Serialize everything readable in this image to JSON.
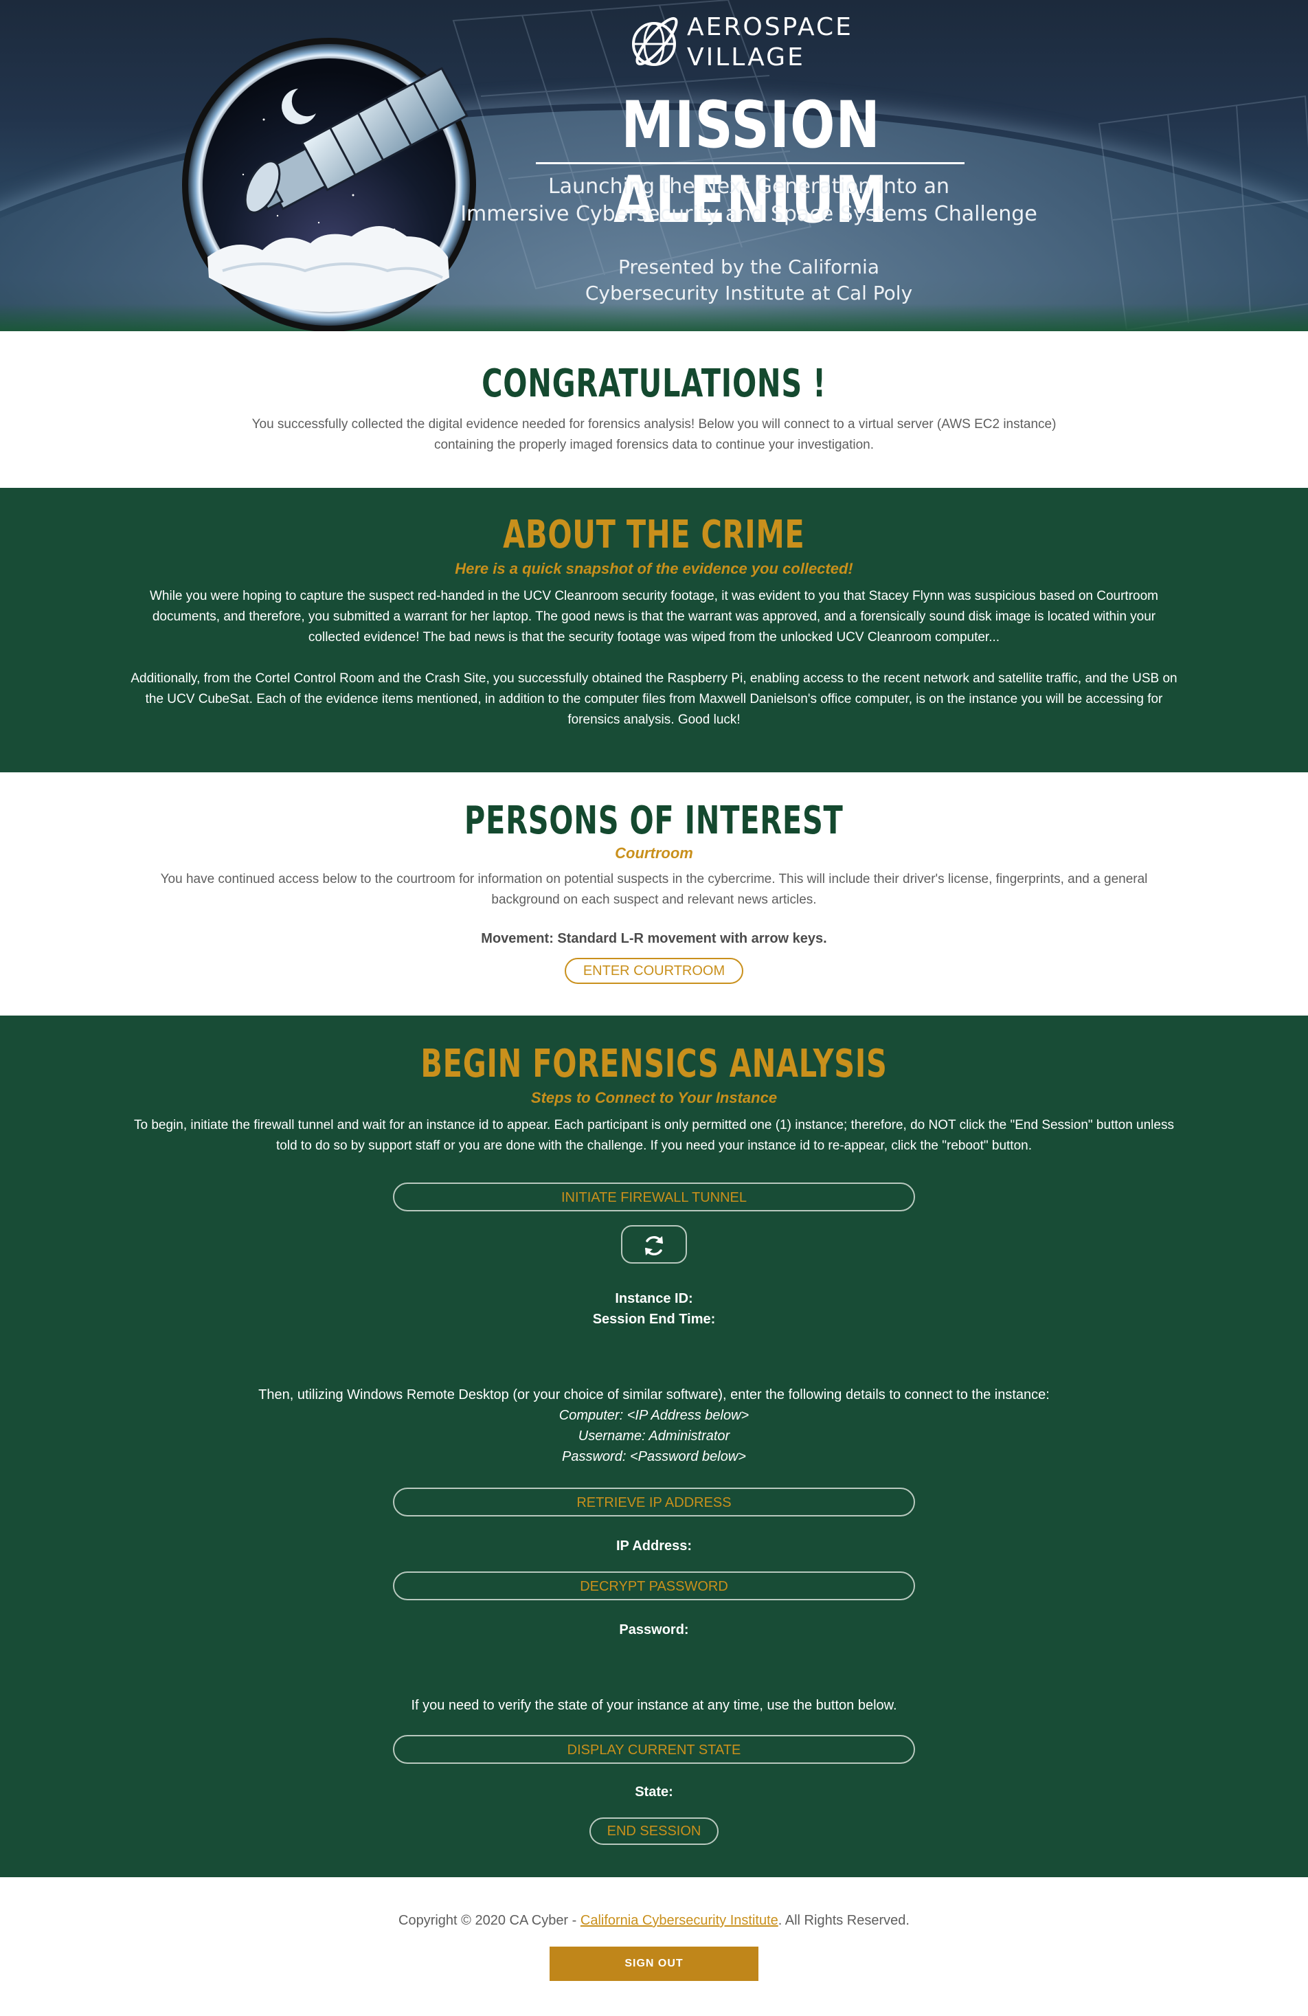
{
  "hero": {
    "logo_line1": "AEROSPACE",
    "logo_line2": "VILLAGE",
    "title": "MISSION ALENIUM",
    "subtitle_line1": "Launching the Next Generation into an",
    "subtitle_line2": "Immersive Cybersecurity and Space Systems Challenge",
    "presented_line1": "Presented by the California",
    "presented_line2": "Cybersecurity Institute at Cal Poly"
  },
  "congrats": {
    "heading": "CONGRATULATIONS !",
    "text": "You successfully collected the digital evidence needed for forensics analysis! Below you will connect to a virtual server (AWS EC2 instance) containing the properly imaged forensics data to continue your investigation."
  },
  "crime": {
    "heading": "ABOUT THE CRIME",
    "subheading": "Here is a quick snapshot of the evidence you collected!",
    "paragraph1": "While you were hoping to capture the suspect red-handed in the UCV Cleanroom security footage, it was evident to you that Stacey Flynn was suspicious based on Courtroom documents, and therefore, you submitted a warrant for her laptop. The good news is that the warrant was approved, and a forensically sound disk image is located within your collected evidence! The bad news is that the security footage was wiped from the unlocked UCV Cleanroom computer...",
    "paragraph2": "Additionally, from the Cortel Control Room and the Crash Site, you successfully obtained the Raspberry Pi, enabling access to the recent network and satellite traffic, and the USB on the UCV CubeSat. Each of the evidence items mentioned, in addition to the computer files from Maxwell Danielson's office computer, is on the instance you will be accessing for forensics analysis. Good luck!"
  },
  "persons": {
    "heading": "PERSONS OF INTEREST",
    "subheading": "Courtroom",
    "text": "You have continued access below to the courtroom for information on potential suspects in the cybercrime. This will include their driver's license, fingerprints, and a general background on each suspect and relevant news articles.",
    "movement": "Movement: Standard L-R movement with arrow keys.",
    "button": "ENTER COURTROOM"
  },
  "forensics": {
    "heading": "BEGIN FORENSICS ANALYSIS",
    "subheading": "Steps to Connect to Your Instance",
    "intro": "To begin, initiate the firewall tunnel and wait for an instance id to appear. Each participant is only permitted one (1) instance; therefore, do NOT click the \"End Session\" button unless told to do so by support staff or you are done with the challenge. If you need your instance id to re-appear, click the \"reboot\" button.",
    "tunnel_button": "INITIATE FIREWALL TUNNEL",
    "refresh_icon": "refresh-icon",
    "instance_id_label": "Instance ID:",
    "session_end_label": "Session End Time:",
    "rdp_intro": "Then, utilizing Windows Remote Desktop (or your choice of similar software), enter the following details to connect to the instance:",
    "rdp_computer": "Computer: <IP Address below>",
    "rdp_username": "Username: Administrator",
    "rdp_password": "Password: <Password below>",
    "ip_button": "RETRIEVE IP ADDRESS",
    "ip_label": "IP Address:",
    "decrypt_button": "DECRYPT PASSWORD",
    "password_label": "Password:",
    "verify_text": "If you need to verify the state of your instance at any time, use the button below.",
    "state_button": "DISPLAY CURRENT STATE",
    "state_label": "State:",
    "end_button": "END SESSION"
  },
  "footer": {
    "copyright_prefix": "Copyright © 2020 CA Cyber - ",
    "link_text": "California Cybersecurity Institute",
    "copyright_suffix": ". All Rights Reserved.",
    "signout": "SIGN OUT"
  },
  "colors": {
    "green": "#184c36",
    "dark_green_heading": "#14492f",
    "gold": "#c9901c",
    "signout_bg": "#c0861a"
  }
}
